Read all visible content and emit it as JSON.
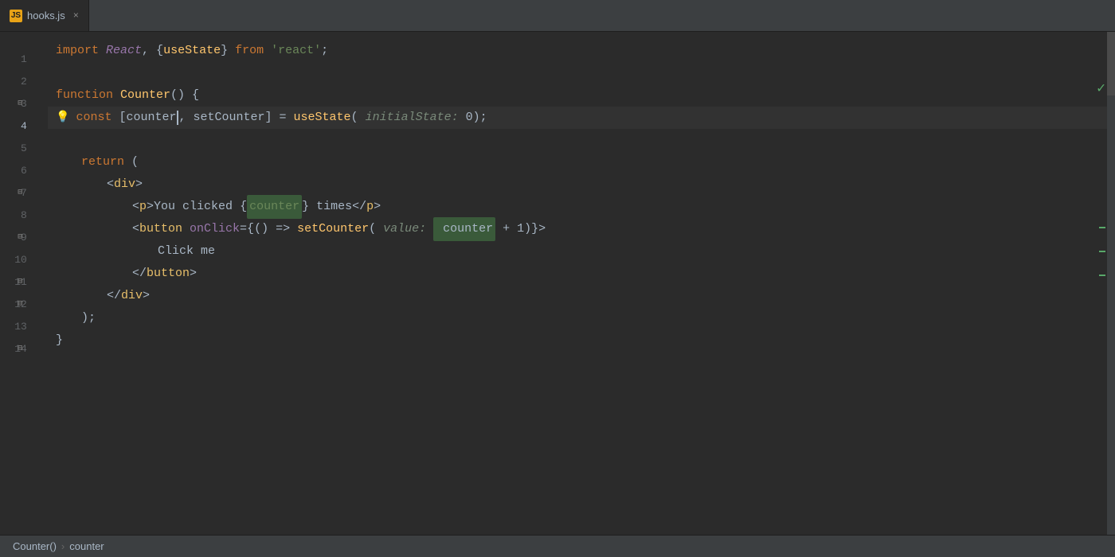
{
  "tab": {
    "icon_label": "JS",
    "filename": "hooks.js",
    "close_label": "×"
  },
  "status_bar": {
    "function_name": "Counter()",
    "separator": "›",
    "variable_name": "counter"
  },
  "checkmark": "✓",
  "code": {
    "line1": "import React, {useState} from 'react';",
    "line2": "",
    "line3": "function Counter() {",
    "line4_indent": "    const [counter",
    "line4_cursor": "",
    "line4_rest": ", setCounter] = useState(",
    "line4_hint": "initialState:",
    "line4_hint_val": " 0",
    "line4_end": ");",
    "line5": "",
    "line6_indent": "    return (",
    "line7_indent": "        <div>",
    "line8_indent": "            <p>You clicked {",
    "line8_hl": "counter",
    "line8_rest": "} times</p>",
    "line9_indent": "        <button onClick={() => setCounter(",
    "line9_hint": "value:",
    "line9_hl": " counter",
    "line9_rest": " + 1)}>",
    "line10_indent": "            Click me",
    "line11_indent": "        </button>",
    "line12_indent": "    </div>",
    "line13_indent": "    );",
    "line14_indent": "}"
  }
}
